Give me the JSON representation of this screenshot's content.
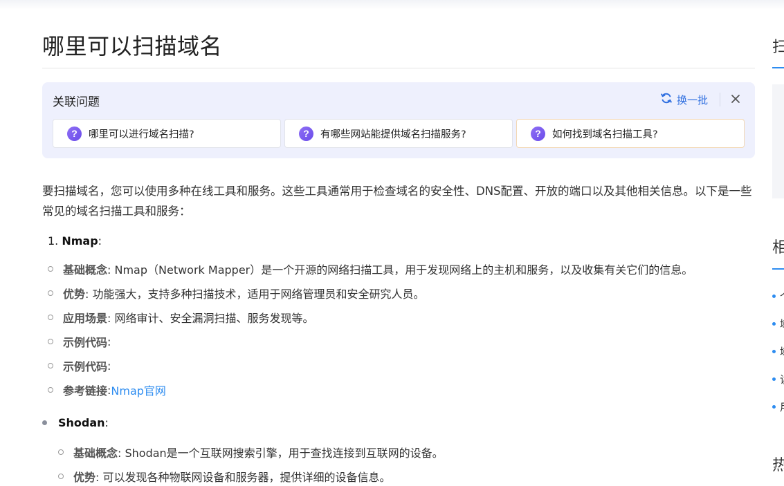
{
  "page": {
    "title": "哪里可以扫描域名"
  },
  "related": {
    "heading": "关联问题",
    "refresh_label": "换一批",
    "questions": [
      {
        "text": "哪里可以进行域名扫描?"
      },
      {
        "text": "有哪些网站能提供域名扫描服务?"
      },
      {
        "text": "如何找到域名扫描工具?"
      }
    ],
    "question_icon": "?"
  },
  "answer": {
    "intro": "要扫描域名，您可以使用多种在线工具和服务。这些工具通常用于检查域名的安全性、DNS配置、开放的端口以及其他相关信息。以下是一些常见的域名扫描工具和服务：",
    "item1": {
      "number": "1.",
      "name": "Nmap",
      "colon": ":"
    },
    "nmap_points": [
      {
        "label": "基础概念",
        "text": ": Nmap（Network Mapper）是一个开源的网络扫描工具，用于发现网络上的主机和服务，以及收集有关它们的信息。"
      },
      {
        "label": "优势",
        "text": ": 功能强大，支持多种扫描技术，适用于网络管理员和安全研究人员。"
      },
      {
        "label": "应用场景",
        "text": ": 网络审计、安全漏洞扫描、服务发现等。"
      },
      {
        "label": "示例代码",
        "text": ":"
      },
      {
        "label": "示例代码",
        "text": ":"
      },
      {
        "label": "参考链接",
        "text": ": ",
        "link": "Nmap官网"
      }
    ],
    "item2": {
      "name": "Shodan",
      "colon": ":"
    },
    "shodan_points": [
      {
        "label": "基础概念",
        "text": ": Shodan是一个互联网搜索引擎，用于查找连接到互联网的设备。"
      },
      {
        "label": "优势",
        "text": ": 可以发现各种物联网设备和服务器，提供详细的设备信息。"
      }
    ]
  },
  "sidebar": {
    "heading1": "扫",
    "heading2": "相",
    "items": [
      "个",
      "域",
      "域",
      "读",
      "用"
    ],
    "heading3": "热"
  },
  "colors": {
    "accent": "#2d8cf0",
    "related_bg": "#eef0fd",
    "question_icon": "#7b5cf0"
  }
}
